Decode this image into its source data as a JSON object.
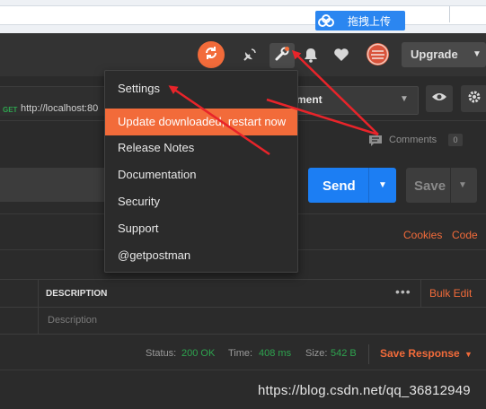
{
  "browser": {
    "baidu_upload_label": "拖拽上传"
  },
  "header": {
    "upgrade_label": "Upgrade",
    "colors": {
      "accent": "#f26b3a",
      "background": "#333333"
    }
  },
  "tab": {
    "method": "GET",
    "url": "http://localhost:80"
  },
  "environment": {
    "selected_label": "ment"
  },
  "comments": {
    "label": "Comments",
    "count": "0"
  },
  "request_bar": {
    "send_label": "Send",
    "save_label": "Save",
    "colors": {
      "send": "#1c7ef3"
    }
  },
  "links": {
    "cookies": "Cookies",
    "code": "Code"
  },
  "params_table": {
    "description_header": "DESCRIPTION",
    "more_icon": "•••",
    "bulk_edit": "Bulk Edit",
    "description_placeholder": "Description"
  },
  "status_bar": {
    "status_label": "Status:",
    "status_value": "200 OK",
    "time_label": "Time:",
    "time_value": "408 ms",
    "size_label": "Size:",
    "size_value": "542 B",
    "save_response": "Save Response",
    "colors": {
      "ok": "#2ea44f"
    }
  },
  "settings_menu": {
    "items": [
      {
        "label": "Settings",
        "highlighted": false
      },
      {
        "label": "Update downloaded, restart now",
        "highlighted": true
      },
      {
        "label": "Release Notes",
        "highlighted": false
      },
      {
        "label": "Documentation",
        "highlighted": false
      },
      {
        "label": "Security",
        "highlighted": false
      },
      {
        "label": "Support",
        "highlighted": false
      },
      {
        "label": "@getpostman",
        "highlighted": false
      }
    ]
  },
  "annotations": {
    "arrow_color": "#e8242a"
  },
  "watermark": "https://blog.csdn.net/qq_36812949"
}
